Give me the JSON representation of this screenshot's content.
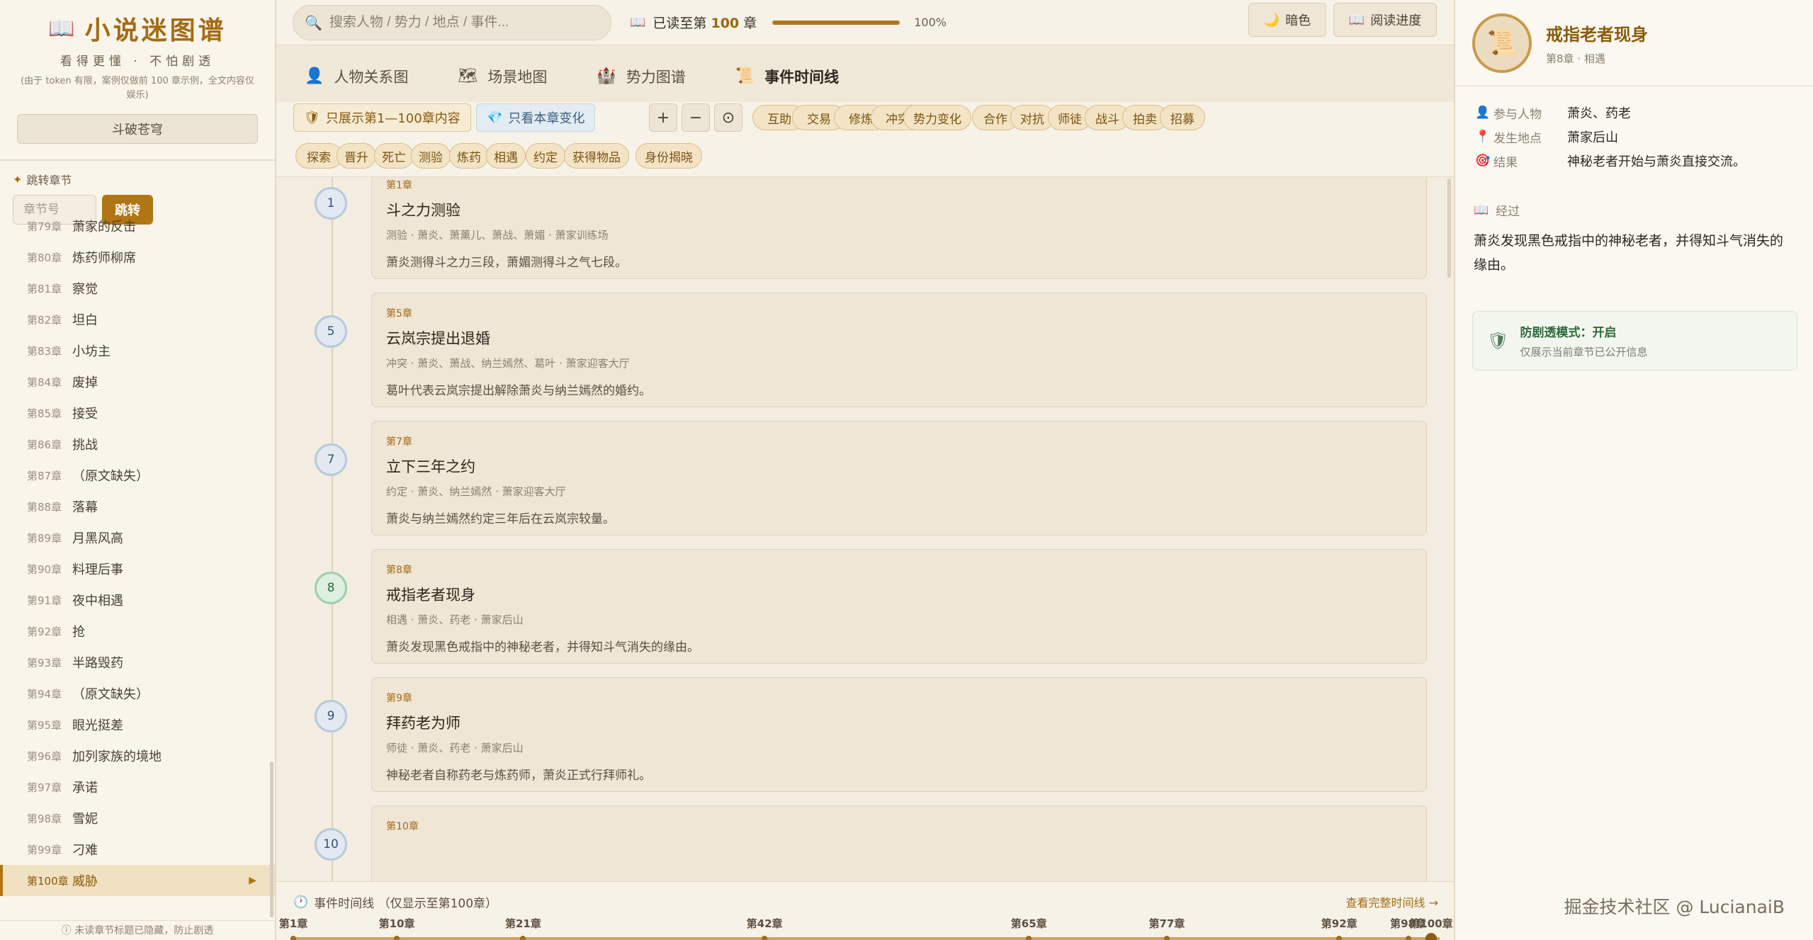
{
  "brand": {
    "title": "小说迷图谱",
    "slogan": "看得更懂 · 不怕剧透",
    "note": "(由于 token 有限，案例仅做前 100 章示例，全文内容仅娱乐)",
    "book_button": "斗破苍穹"
  },
  "jump": {
    "label": "跳转章节",
    "placeholder": "章节号",
    "button": "跳转"
  },
  "chapters": [
    {
      "no": "第79章",
      "name": "萧家的反击"
    },
    {
      "no": "第80章",
      "name": "炼药师柳席"
    },
    {
      "no": "第81章",
      "name": "察觉"
    },
    {
      "no": "第82章",
      "name": "坦白"
    },
    {
      "no": "第83章",
      "name": "小坊主"
    },
    {
      "no": "第84章",
      "name": "废掉"
    },
    {
      "no": "第85章",
      "name": "接受"
    },
    {
      "no": "第86章",
      "name": "挑战"
    },
    {
      "no": "第87章",
      "name": "（原文缺失）"
    },
    {
      "no": "第88章",
      "name": "落幕"
    },
    {
      "no": "第89章",
      "name": "月黑风高"
    },
    {
      "no": "第90章",
      "name": "料理后事"
    },
    {
      "no": "第91章",
      "name": "夜中相遇"
    },
    {
      "no": "第92章",
      "name": "抢"
    },
    {
      "no": "第93章",
      "name": "半路毁药"
    },
    {
      "no": "第94章",
      "name": "（原文缺失）"
    },
    {
      "no": "第95章",
      "name": "眼光挺差"
    },
    {
      "no": "第96章",
      "name": "加列家族的境地"
    },
    {
      "no": "第97章",
      "name": "承诺"
    },
    {
      "no": "第98章",
      "name": "雪妮"
    },
    {
      "no": "第99章",
      "name": "刁难"
    },
    {
      "no": "第100章",
      "name": "威胁"
    }
  ],
  "hidden_note": "ⓘ 未读章节标题已隐藏，防止剧透",
  "search": {
    "placeholder": "搜索人物 / 势力 / 地点 / 事件..."
  },
  "progress": {
    "prefix": "已读至第",
    "chapter": "100",
    "suffix": "章",
    "percent": "100%",
    "fraction": 1.0
  },
  "top_buttons": {
    "dark": "暗色",
    "reading": "阅读进度"
  },
  "tabs": [
    {
      "label": "人物关系图",
      "icon": "person-icon"
    },
    {
      "label": "场景地图",
      "icon": "map-icon"
    },
    {
      "label": "势力图谱",
      "icon": "castle-icon"
    },
    {
      "label": "事件时间线",
      "icon": "scroll-icon"
    }
  ],
  "filters": {
    "range": "只展示第1—100章内容",
    "change": "只看本章变化",
    "zoom_in": "+",
    "zoom_out": "−",
    "reset": "⊙",
    "tags": [
      "互助",
      "交易",
      "修炼",
      "冲突",
      "势力变化",
      "合作",
      "对抗",
      "师徒",
      "战斗",
      "拍卖",
      "招募",
      "探索",
      "晋升",
      "死亡",
      "测验",
      "炼药",
      "相遇",
      "约定",
      "获得物品",
      "身份揭晓"
    ]
  },
  "events": [
    {
      "node": "1",
      "chapter": "第1章",
      "title": "斗之力测验",
      "meta": "测验 · 萧炎、萧薰儿、萧战、萧媚 · 萧家训练场",
      "desc": "萧炎测得斗之力三段，萧媚测得斗之气七段。"
    },
    {
      "node": "5",
      "chapter": "第5章",
      "title": "云岚宗提出退婚",
      "meta": "冲突 · 萧炎、萧战、纳兰嫣然、葛叶 · 萧家迎客大厅",
      "desc": "葛叶代表云岚宗提出解除萧炎与纳兰嫣然的婚约。"
    },
    {
      "node": "7",
      "chapter": "第7章",
      "title": "立下三年之约",
      "meta": "约定 · 萧炎、纳兰嫣然 · 萧家迎客大厅",
      "desc": "萧炎与纳兰嫣然约定三年后在云岚宗较量。"
    },
    {
      "node": "8",
      "chapter": "第8章",
      "title": "戒指老者现身",
      "meta": "相遇 · 萧炎、药老 · 萧家后山",
      "desc": "萧炎发现黑色戒指中的神秘老者，并得知斗气消失的缘由。"
    },
    {
      "node": "9",
      "chapter": "第9章",
      "title": "拜药老为师",
      "meta": "师徒 · 萧炎、药老 · 萧家后山",
      "desc": "神秘老者自称药老与炼药师，萧炎正式行拜师礼。"
    },
    {
      "node": "10",
      "chapter": "第10章",
      "title": "",
      "meta": "",
      "desc": ""
    }
  ],
  "bottom": {
    "title": "事件时间线 （仅显示至第100章）",
    "link": "查看完整时间线 →",
    "ticks": [
      "第1章",
      "第10章",
      "第21章",
      "第42章",
      "第65章",
      "第77章",
      "第92章",
      "第98章",
      "第100章"
    ],
    "tick_values": [
      1,
      10,
      21,
      42,
      65,
      77,
      92,
      98,
      100
    ]
  },
  "detail": {
    "title": "戒指老者现身",
    "sub": "第8章 · 相遇",
    "rows": [
      {
        "label": "参与人物",
        "value": "萧炎、药老"
      },
      {
        "label": "发生地点",
        "value": "萧家后山"
      },
      {
        "label": "结果",
        "value": "神秘老者开始与萧炎直接交流。"
      }
    ],
    "process_label": "经过",
    "process": "萧炎发现黑色戒指中的神秘老者，并得知斗气消失的缘由。",
    "spoiler_title": "防剧透模式：开启",
    "spoiler_sub": "仅展示当前章节已公开信息"
  },
  "watermark": "掘金技术社区 @ LucianaiB",
  "colors": {
    "accent": "#b17614",
    "active_bg": "#f0e1c2",
    "node_blue": "#b9c9dc",
    "node_green": "#9fcfa9"
  }
}
